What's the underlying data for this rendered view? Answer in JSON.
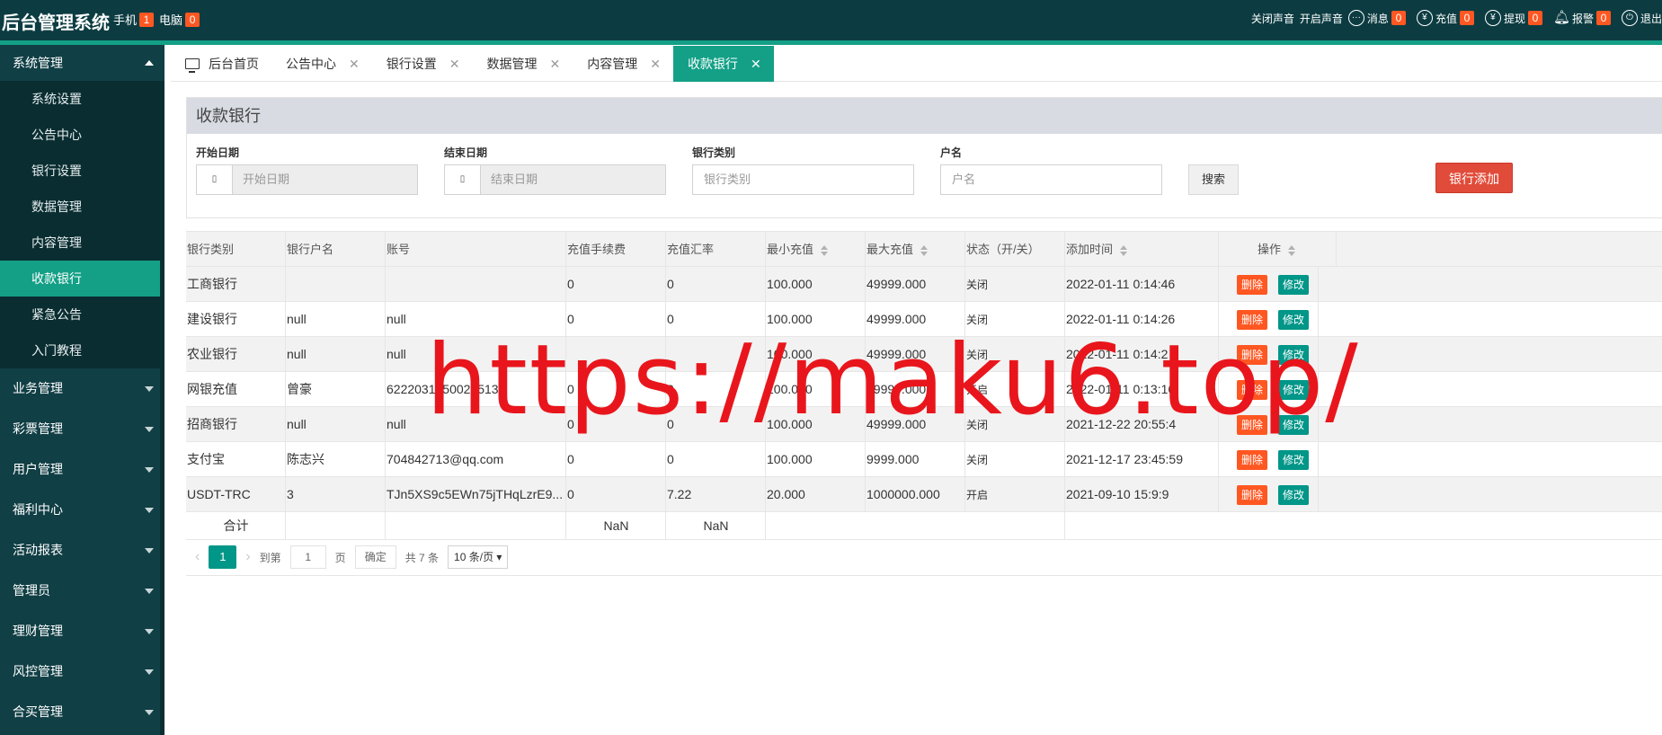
{
  "header": {
    "brand": "后台管理系统",
    "devices": [
      {
        "label": "手机",
        "count": "1"
      },
      {
        "label": "电脑",
        "count": "0"
      }
    ],
    "sound_off": "关闭声音",
    "sound_on": "开启声音",
    "message": {
      "label": "消息",
      "count": "0"
    },
    "recharge": {
      "label": "充值",
      "count": "0"
    },
    "withdraw": {
      "label": "提现",
      "count": "0"
    },
    "alarm": {
      "label": "报警",
      "count": "0"
    },
    "logout": "退出"
  },
  "sidebar": {
    "open_group": "系统管理",
    "sub_items": [
      "系统设置",
      "公告中心",
      "银行设置",
      "数据管理",
      "内容管理",
      "收款银行",
      "紧急公告",
      "入门教程"
    ],
    "active_sub": "收款银行",
    "groups": [
      "业务管理",
      "彩票管理",
      "用户管理",
      "福利中心",
      "活动报表",
      "管理员",
      "理财管理",
      "风控管理",
      "合买管理"
    ]
  },
  "tabs": [
    {
      "label": "后台首页",
      "closable": false
    },
    {
      "label": "公告中心",
      "closable": true
    },
    {
      "label": "银行设置",
      "closable": true
    },
    {
      "label": "数据管理",
      "closable": true
    },
    {
      "label": "内容管理",
      "closable": true
    },
    {
      "label": "收款银行",
      "closable": true,
      "active": true
    }
  ],
  "panel": {
    "title": "收款银行",
    "filters": {
      "start_label": "开始日期",
      "start_placeholder": "开始日期",
      "end_label": "结束日期",
      "end_placeholder": "结束日期",
      "bank_type_label": "银行类别",
      "bank_type_placeholder": "银行类别",
      "account_name_label": "户名",
      "account_name_placeholder": "户名",
      "search": "搜索",
      "add": "银行添加"
    }
  },
  "table": {
    "columns": [
      "银行类别",
      "银行户名",
      "账号",
      "充值手续费",
      "充值汇率",
      "最小充值",
      "最大充值",
      "状态（开/关）",
      "添加时间",
      "操作"
    ],
    "rows": [
      {
        "bank": "工商银行",
        "holder": "",
        "account": "",
        "fee": "0",
        "rate": "0",
        "min": "100.000",
        "max": "49999.000",
        "state": "关闭",
        "time": "2022-01-11 0:14:46"
      },
      {
        "bank": "建设银行",
        "holder": "null",
        "account": "null",
        "fee": "0",
        "rate": "0",
        "min": "100.000",
        "max": "49999.000",
        "state": "关闭",
        "time": "2022-01-11 0:14:26"
      },
      {
        "bank": "农业银行",
        "holder": "null",
        "account": "null",
        "fee": "",
        "rate": "",
        "min": "100.000",
        "max": "49999.000",
        "state": "关闭",
        "time": "2022-01-11 0:14:2"
      },
      {
        "bank": "网银充值",
        "holder": "曾豪",
        "account": "6222031050029513",
        "fee": "0",
        "rate": "0",
        "min": "100.000",
        "max": "49999.000",
        "state": "开启",
        "time": "2022-01-11 0:13:16"
      },
      {
        "bank": "招商银行",
        "holder": "null",
        "account": "null",
        "fee": "0",
        "rate": "0",
        "min": "100.000",
        "max": "49999.000",
        "state": "关闭",
        "time": "2021-12-22 20:55:4"
      },
      {
        "bank": "支付宝",
        "holder": "陈志兴",
        "account": "704842713@qq.com",
        "fee": "0",
        "rate": "0",
        "min": "100.000",
        "max": "9999.000",
        "state": "关闭",
        "time": "2021-12-17 23:45:59"
      },
      {
        "bank": "USDT-TRC",
        "holder": "3",
        "account": "TJn5XS9c5EWn75jTHqLzrE9...",
        "fee": "0",
        "rate": "7.22",
        "min": "20.000",
        "max": "1000000.000",
        "state": "开启",
        "time": "2021-09-10 15:9:9"
      }
    ],
    "delete_label": "删除",
    "edit_label": "修改",
    "total_label": "合计",
    "total_fee": "NaN",
    "total_rate": "NaN"
  },
  "pager": {
    "current": "1",
    "goto_label": "到第",
    "goto_value": "1",
    "page_unit": "页",
    "confirm": "确定",
    "total": "共 7 条",
    "page_size": "10 条/页"
  },
  "watermark": "https://maku6.top/"
}
